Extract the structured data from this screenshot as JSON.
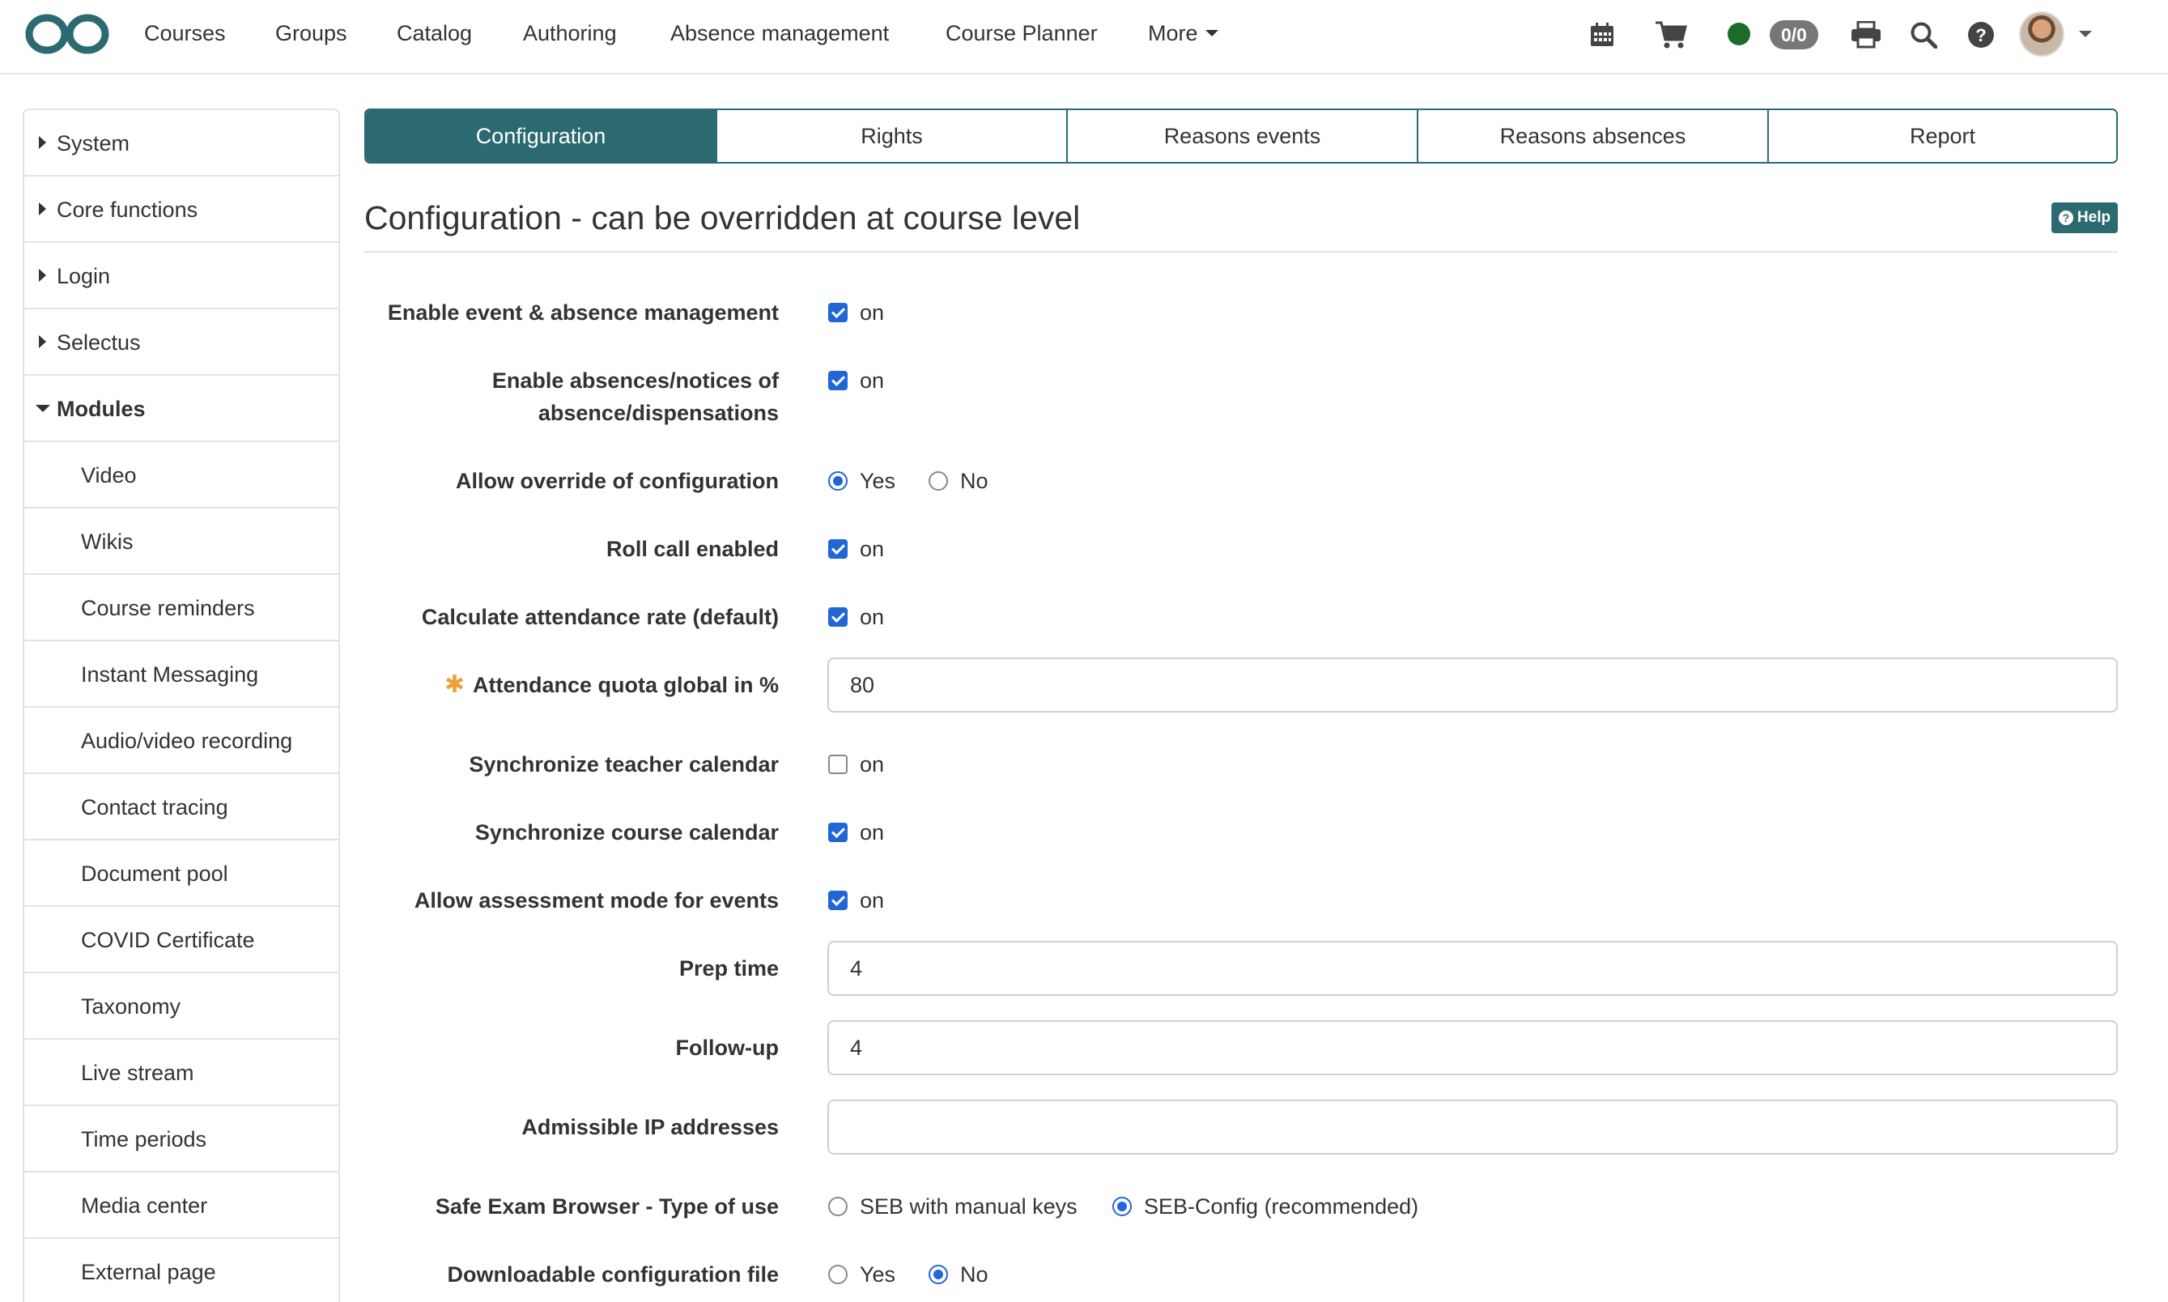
{
  "topnav": {
    "items": [
      "Courses",
      "Groups",
      "Catalog",
      "Authoring",
      "Absence management",
      "Course Planner",
      "More"
    ],
    "badge": "0/0"
  },
  "sidebar": {
    "items": [
      {
        "label": "System",
        "state": "collapsed"
      },
      {
        "label": "Core functions",
        "state": "collapsed"
      },
      {
        "label": "Login",
        "state": "collapsed"
      },
      {
        "label": "Selectus",
        "state": "collapsed"
      },
      {
        "label": "Modules",
        "state": "expanded"
      },
      {
        "label": "Video"
      },
      {
        "label": "Wikis"
      },
      {
        "label": "Course reminders"
      },
      {
        "label": "Instant Messaging"
      },
      {
        "label": "Audio/video recording"
      },
      {
        "label": "Contact tracing"
      },
      {
        "label": "Document pool"
      },
      {
        "label": "COVID Certificate"
      },
      {
        "label": "Taxonomy"
      },
      {
        "label": "Live stream"
      },
      {
        "label": "Time periods"
      },
      {
        "label": "Media center"
      },
      {
        "label": "External page"
      }
    ]
  },
  "tabs": [
    "Configuration",
    "Rights",
    "Reasons events",
    "Reasons absences",
    "Report"
  ],
  "active_tab": "Configuration",
  "page": {
    "title": "Configuration - can be overridden at course level",
    "help": "Help"
  },
  "form": {
    "on_label": "on",
    "yes_label": "Yes",
    "no_label": "No",
    "enable_event": {
      "label": "Enable event & absence management",
      "checked": true
    },
    "enable_absences": {
      "label_line1": "Enable absences/notices of",
      "label_line2": "absence/dispensations",
      "checked": true
    },
    "allow_override": {
      "label": "Allow override of configuration",
      "selected": "Yes"
    },
    "roll_call": {
      "label": "Roll call enabled",
      "checked": true
    },
    "attendance_rate": {
      "label": "Calculate attendance rate (default)",
      "checked": true
    },
    "attendance_quota": {
      "label": "Attendance quota global in %",
      "value": "80",
      "required": true
    },
    "sync_teacher": {
      "label": "Synchronize teacher calendar",
      "checked": false
    },
    "sync_course": {
      "label": "Synchronize course calendar",
      "checked": true
    },
    "assessment_mode": {
      "label": "Allow assessment mode for events",
      "checked": true
    },
    "prep_time": {
      "label": "Prep time",
      "value": "4"
    },
    "follow_up": {
      "label": "Follow-up",
      "value": "4"
    },
    "ip_addresses": {
      "label": "Admissible IP addresses",
      "value": ""
    },
    "seb_type": {
      "label": "Safe Exam Browser - Type of use",
      "options": [
        "SEB with manual keys",
        "SEB-Config (recommended)"
      ],
      "selected": "SEB-Config (recommended)"
    },
    "download_config": {
      "label": "Downloadable configuration file",
      "selected": "No"
    }
  },
  "colors": {
    "accent": "#2b6a70",
    "checkbox": "#2166d6",
    "online_status": "#1b6b2b",
    "required": "#e8a33a"
  }
}
